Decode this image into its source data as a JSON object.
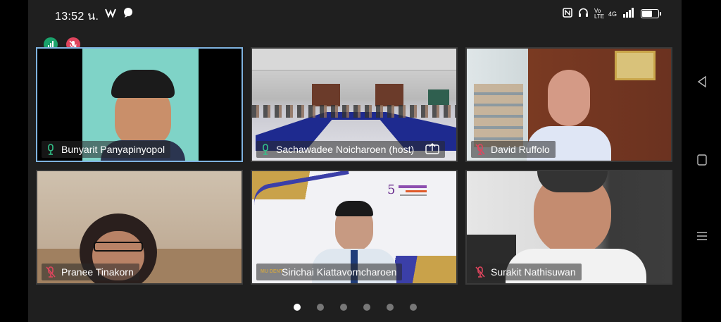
{
  "status_bar": {
    "time": "13:52 น.",
    "icons_left": [
      "app-notification-icon",
      "chat-notification-icon"
    ],
    "icons_right": [
      "nfc-icon",
      "headphones-icon",
      "volte-icon",
      "signal-icon",
      "battery-icon"
    ],
    "network": "4G",
    "volte_label": "Vo LTE"
  },
  "top_badges": [
    {
      "name": "signal-badge",
      "color": "#1aa36c"
    },
    {
      "name": "mute-badge",
      "color": "#e0455e"
    }
  ],
  "participants": [
    {
      "name": "Bunyarit Panyapinyopol",
      "mic": "on",
      "active": true
    },
    {
      "name": "Sachawadee Noicharoen (host)",
      "mic": "on",
      "sharing": true
    },
    {
      "name": "David Ruffolo",
      "mic": "muted"
    },
    {
      "name": "Pranee Tinakorn",
      "mic": "muted"
    },
    {
      "name": "Sirichai Kiattavorncharoen",
      "mic": "off",
      "logo_text": "MU DENT"
    },
    {
      "name": "Surakit Nathisuwan",
      "mic": "muted"
    }
  ],
  "pager": {
    "count": 6,
    "active_index": 0
  },
  "colors": {
    "active_border": "#7fb3e0",
    "mic_on": "#33c48b",
    "mic_muted": "#e0455e"
  }
}
